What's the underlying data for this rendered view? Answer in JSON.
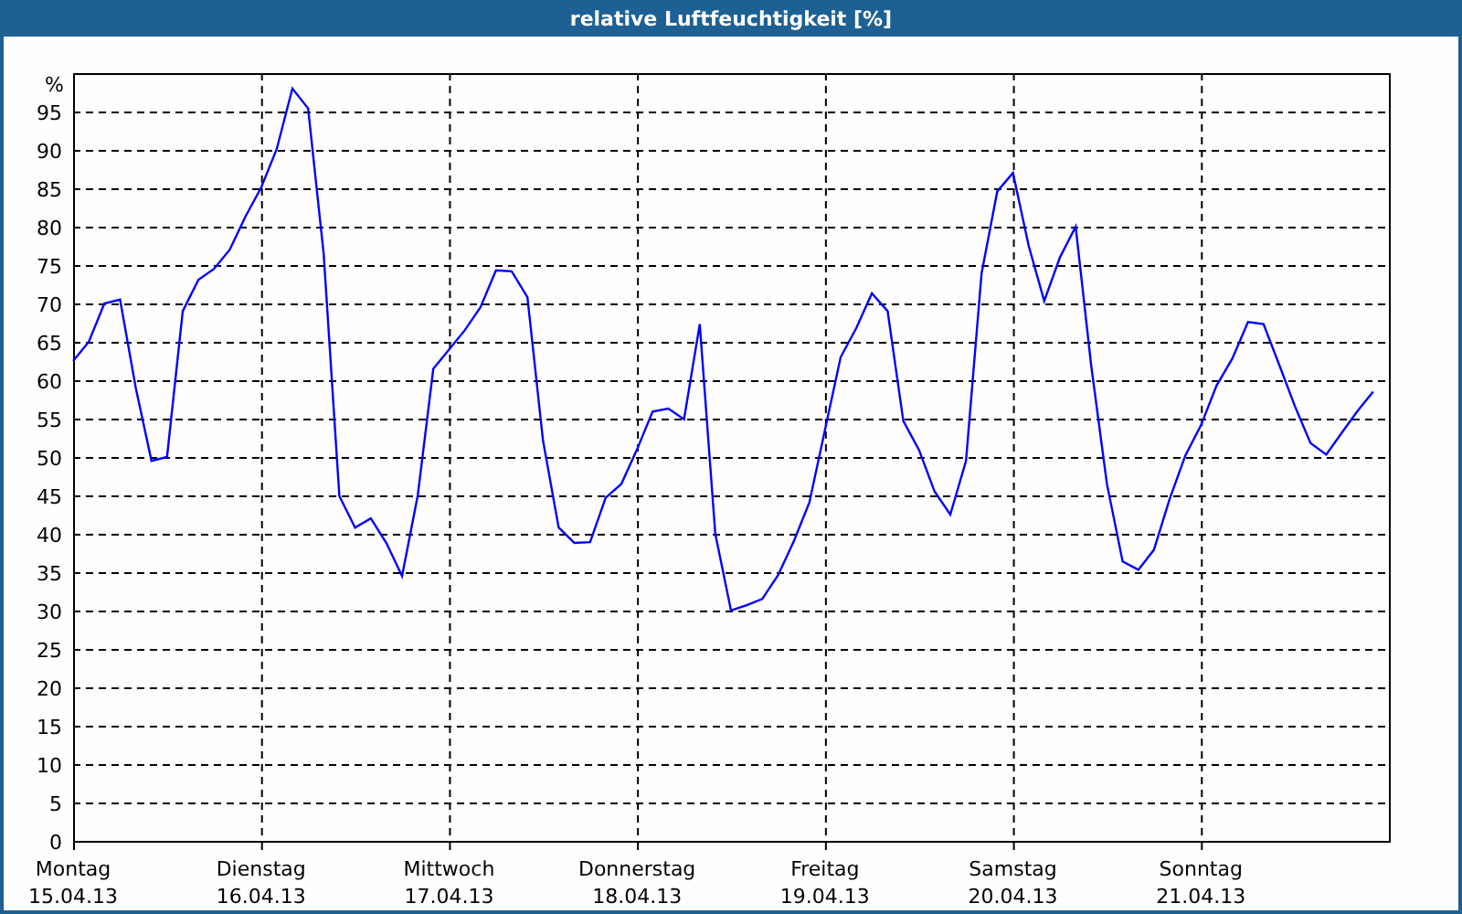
{
  "chart_data": {
    "type": "line",
    "title": "relative Luftfeuchtigkeit [%]",
    "ylabel": "%",
    "categories": [
      "Montag",
      null,
      null,
      null,
      null,
      null,
      null,
      null,
      null,
      null,
      null,
      null,
      "Dienstag",
      null,
      null,
      null,
      null,
      null,
      null,
      null,
      null,
      null,
      null,
      null,
      "Mittwoch",
      null,
      null,
      null,
      null,
      null,
      null,
      null,
      null,
      null,
      null,
      null,
      "Donnerstag",
      null,
      null,
      null,
      null,
      null,
      null,
      null,
      null,
      null,
      null,
      null,
      "Freitag",
      null,
      null,
      null,
      null,
      null,
      null,
      null,
      null,
      null,
      null,
      null,
      "Samstag",
      null,
      null,
      null,
      null,
      null,
      null,
      null,
      null,
      null,
      null,
      null,
      "Sonntag",
      null,
      null,
      null,
      null,
      null,
      null,
      null,
      null,
      null,
      null,
      null
    ],
    "series": [
      {
        "color": "#0000ff",
        "values": [
          62.5,
          65,
          70,
          70.5,
          59,
          49.5,
          50,
          69,
          73.1,
          74.5,
          77,
          81.3,
          85.1,
          90.1,
          98,
          95.4,
          76.5,
          44.9,
          40.8,
          42,
          38.8,
          34.5,
          45,
          61.5,
          64,
          66.5,
          69.5,
          74.3,
          74.2,
          70.8,
          52.2,
          40.8,
          38.8,
          38.9,
          44.7,
          46.5,
          51,
          55.9,
          56.3,
          54.9,
          67.3,
          40,
          30,
          30.7,
          31.5,
          34.6,
          39,
          44.1,
          53.5,
          63,
          66.8,
          71.3,
          69,
          54.7,
          50.9,
          45.5,
          42.5,
          49.5,
          73.9,
          84.6,
          87,
          77.5,
          70.3,
          76,
          80,
          61.9,
          46.5,
          36.4,
          35.3,
          37.9,
          44.5,
          50.2,
          54.1,
          59.3,
          62.8,
          67.6,
          67.3,
          62,
          56.6,
          51.8,
          50.3,
          53.2,
          56,
          58.5
        ]
      }
    ],
    "grid": true,
    "ylim": [
      0,
      100
    ],
    "yticks": [
      0,
      5,
      10,
      15,
      20,
      25,
      30,
      35,
      40,
      45,
      50,
      55,
      60,
      65,
      70,
      75,
      80,
      85,
      90,
      95
    ]
  },
  "dates": [
    "15.04.13",
    "16.04.13",
    "17.04.13",
    "18.04.13",
    "19.04.13",
    "20.04.13",
    "21.04.13"
  ]
}
